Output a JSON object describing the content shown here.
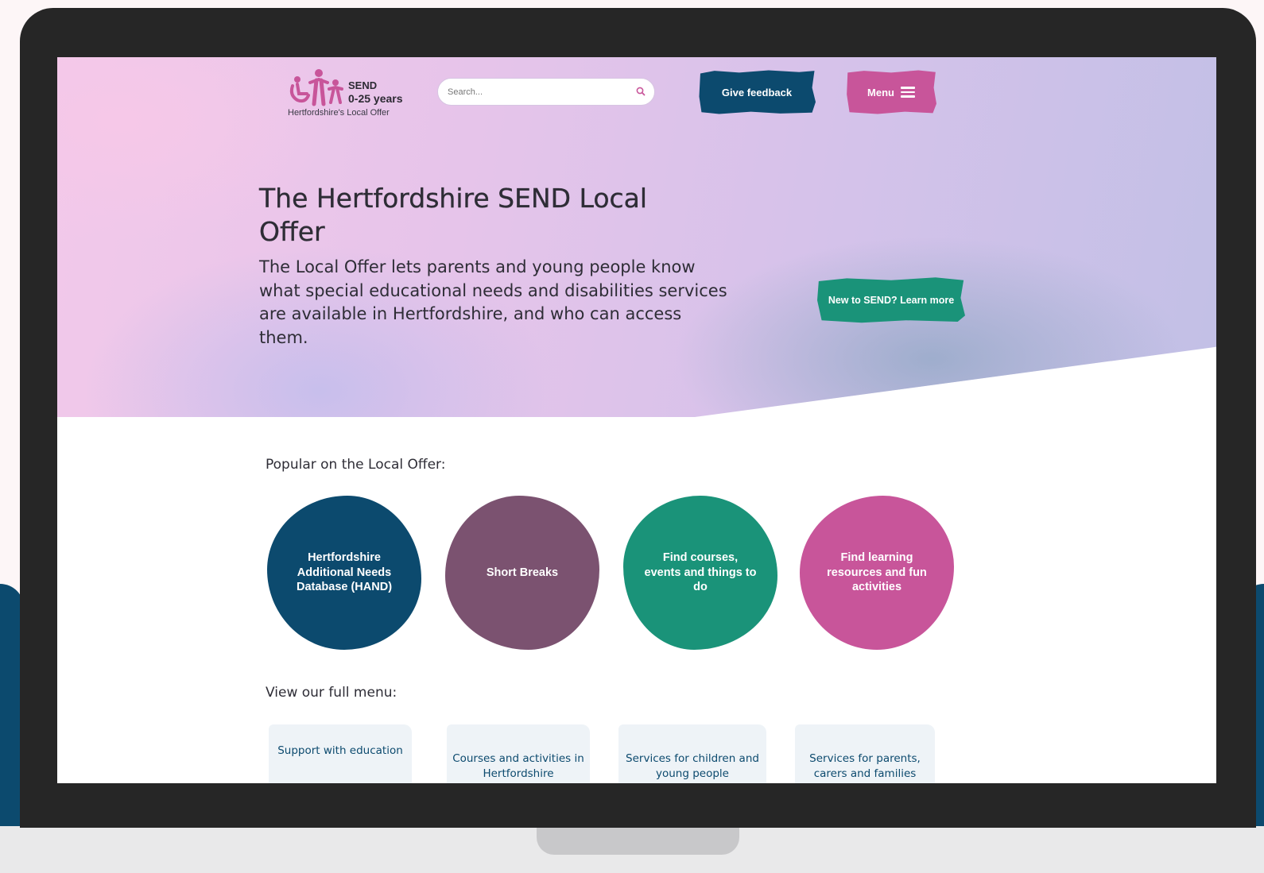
{
  "header": {
    "logo": {
      "line1": "SEND",
      "line2": "0-25 years",
      "subtitle": "Hertfordshire's Local Offer"
    },
    "search": {
      "placeholder": "Search..."
    },
    "feedback_label": "Give feedback",
    "menu_label": "Menu"
  },
  "hero": {
    "title": "The Hertfordshire SEND Local Offer",
    "text": "The Local Offer lets parents and young people know what special educational needs and disabilities services are available in Hertfordshire, and who can access them.",
    "learn_more_label": "New to SEND? Learn more"
  },
  "popular": {
    "label": "Popular on the Local Offer:",
    "items": [
      {
        "label": "Hertfordshire Additional Needs Database (HAND)"
      },
      {
        "label": "Short Breaks"
      },
      {
        "label": "Find courses, events and things to do"
      },
      {
        "label": "Find learning resources and fun activities"
      }
    ]
  },
  "full_menu": {
    "label": "View our full menu:",
    "items": [
      {
        "label": "Support with education"
      },
      {
        "label": "Courses and activities in Hertfordshire"
      },
      {
        "label": "Services for children and young people"
      },
      {
        "label": "Services for parents, carers and families"
      }
    ]
  },
  "colors": {
    "navy": "#0c4a6e",
    "plum": "#7b5270",
    "teal": "#1a9379",
    "pink": "#c8559a"
  }
}
